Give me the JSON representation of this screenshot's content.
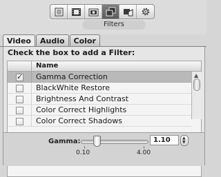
{
  "toolbar": {
    "title": "Filters",
    "buttons": [
      {
        "icon": "list-icon"
      },
      {
        "icon": "film-icon"
      },
      {
        "icon": "camera-icon"
      },
      {
        "icon": "layers-icon",
        "active": true
      },
      {
        "icon": "object-icon"
      },
      {
        "icon": "gear-icon"
      }
    ]
  },
  "tabs": [
    {
      "label": "Video",
      "active": true
    },
    {
      "label": "Audio"
    },
    {
      "label": "Color"
    }
  ],
  "instructions": "Check the box to add a Filter:",
  "list": {
    "header_name": "Name",
    "rows": [
      {
        "name": "Gamma Correction",
        "checked": true,
        "selected": true
      },
      {
        "name": "BlackWhite Restore",
        "checked": false
      },
      {
        "name": "Brightness And Contrast",
        "checked": false
      },
      {
        "name": "Color Correct Highlights",
        "checked": false
      },
      {
        "name": "Color Correct Shadows",
        "checked": false
      }
    ]
  },
  "gamma": {
    "label": "Gamma:",
    "value": "1.10",
    "min_label": "0.10",
    "max_label": "4.00",
    "slider_fraction": 0.26
  },
  "colors": {
    "selected_row": "#b9b9b9",
    "active_segment": "#666666"
  }
}
